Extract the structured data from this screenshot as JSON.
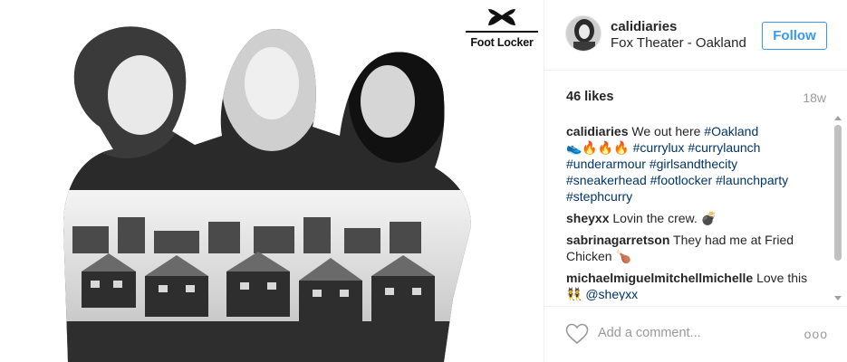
{
  "post": {
    "image": {
      "brand_logo_text": "Foot Locker",
      "brand_icon": "under-armour-logo"
    },
    "author": {
      "username": "calidiaries",
      "location": "Fox Theater - Oakland",
      "follow_label": "Follow"
    },
    "likes": "46 likes",
    "age": "18w",
    "comments": [
      {
        "user": "calidiaries",
        "parts": [
          {
            "text": "We out here ",
            "tag": false
          },
          {
            "text": "#Oakland",
            "tag": true
          },
          {
            "text": "\n👟🔥🔥🔥 ",
            "tag": false
          },
          {
            "text": "#currylux",
            "tag": true
          },
          {
            "text": " ",
            "tag": false
          },
          {
            "text": "#currylaunch",
            "tag": true
          },
          {
            "text": "\n",
            "tag": false
          },
          {
            "text": "#underarmour",
            "tag": true
          },
          {
            "text": " ",
            "tag": false
          },
          {
            "text": "#girlsandthecity",
            "tag": true
          },
          {
            "text": "\n",
            "tag": false
          },
          {
            "text": "#sneakerhead",
            "tag": true
          },
          {
            "text": " ",
            "tag": false
          },
          {
            "text": "#footlocker",
            "tag": true
          },
          {
            "text": " ",
            "tag": false
          },
          {
            "text": "#launchparty",
            "tag": true
          },
          {
            "text": "\n",
            "tag": false
          },
          {
            "text": "#stephcurry",
            "tag": true
          }
        ]
      },
      {
        "user": "sheyxx",
        "parts": [
          {
            "text": "Lovin the crew. 💣",
            "tag": false
          }
        ]
      },
      {
        "user": "sabrinagarretson",
        "parts": [
          {
            "text": "They had me at Fried Chicken 🍗",
            "tag": false
          }
        ]
      },
      {
        "user": "michaelmiguelmitchellmichelle",
        "parts": [
          {
            "text": "Love this\n👯 ",
            "tag": false
          },
          {
            "text": "@sheyxx",
            "tag": true
          }
        ]
      }
    ],
    "add_comment_placeholder": "Add a comment...",
    "more_options": "ooo",
    "colors": {
      "link_blue": "#3897f0",
      "hashtag": "#003569",
      "muted": "#999999",
      "text": "#262626"
    }
  }
}
